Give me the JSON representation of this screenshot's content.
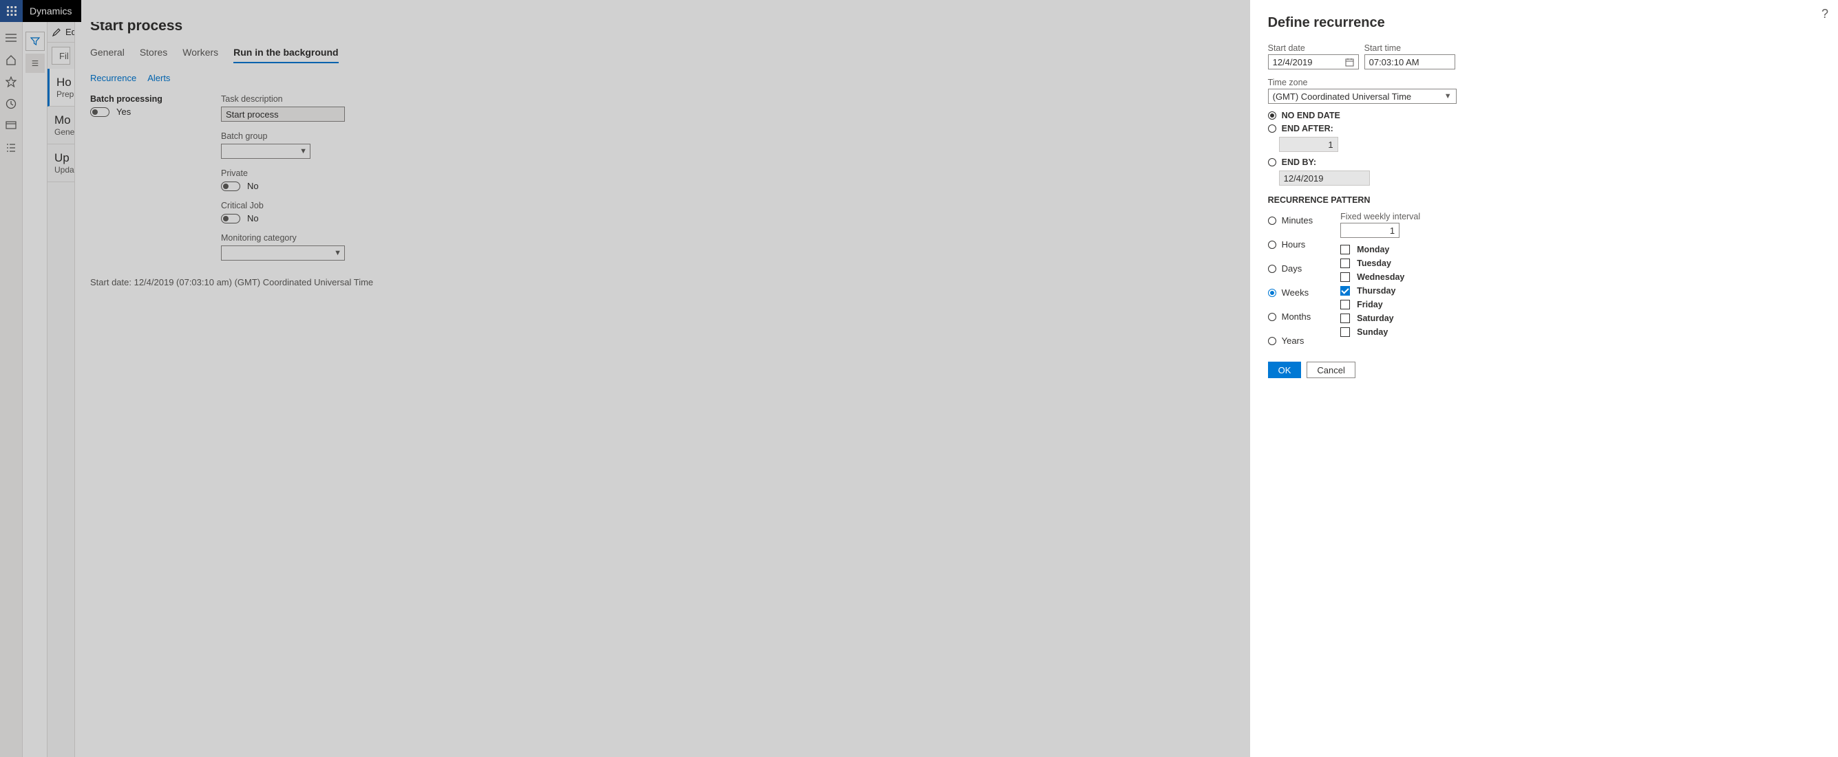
{
  "brand": {
    "app_name": "Dynamics"
  },
  "navcol": {
    "edit_label": "Edit",
    "filter_placeholder": "Fil",
    "items": [
      {
        "title": "Ho",
        "subtitle": "Prep"
      },
      {
        "title": "Mo",
        "subtitle": "Gene"
      },
      {
        "title": "Up",
        "subtitle": "Upda"
      }
    ]
  },
  "main": {
    "title": "Start process",
    "tabs": [
      {
        "label": "General"
      },
      {
        "label": "Stores"
      },
      {
        "label": "Workers"
      },
      {
        "label": "Run in the background"
      }
    ],
    "subtabs": [
      {
        "label": "Recurrence"
      },
      {
        "label": "Alerts"
      }
    ],
    "batch_processing_label": "Batch processing",
    "batch_processing_value": "Yes",
    "task_description_label": "Task description",
    "task_description_value": "Start process",
    "batch_group_label": "Batch group",
    "batch_group_value": "",
    "private_label": "Private",
    "private_value": "No",
    "critical_label": "Critical Job",
    "critical_value": "No",
    "monitoring_label": "Monitoring category",
    "monitoring_value": "",
    "summary": "Start date: 12/4/2019 (07:03:10 am) (GMT) Coordinated Universal Time"
  },
  "panel": {
    "title": "Define recurrence",
    "start_date_label": "Start date",
    "start_date_value": "12/4/2019",
    "start_time_label": "Start time",
    "start_time_value": "07:03:10 AM",
    "timezone_label": "Time zone",
    "timezone_value": "(GMT) Coordinated Universal Time",
    "no_end_label": "No end date",
    "end_after_label": "End after:",
    "end_after_value": "1",
    "end_by_label": "End by:",
    "end_by_value": "12/4/2019",
    "pattern_head": "Recurrence pattern",
    "units": {
      "minutes": "Minutes",
      "hours": "Hours",
      "days": "Days",
      "weeks": "Weeks",
      "months": "Months",
      "years": "Years"
    },
    "interval_label": "Fixed weekly interval",
    "interval_value": "1",
    "days": {
      "mon": "Monday",
      "tue": "Tuesday",
      "wed": "Wednesday",
      "thu": "Thursday",
      "fri": "Friday",
      "sat": "Saturday",
      "sun": "Sunday"
    },
    "ok_label": "OK",
    "cancel_label": "Cancel"
  }
}
